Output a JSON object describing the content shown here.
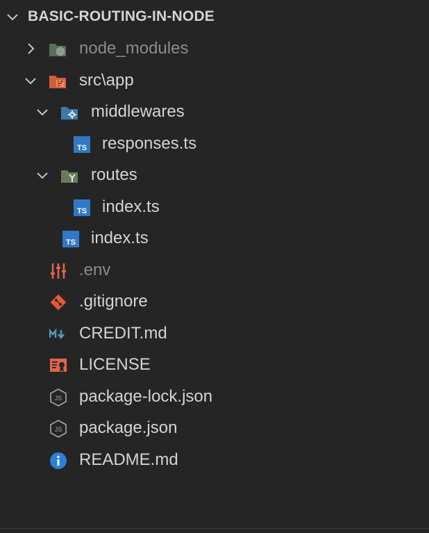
{
  "explorer": {
    "title": "BASIC-ROUTING-IN-NODE",
    "items": [
      {
        "label": "node_modules",
        "kind": "folder-closed",
        "icon": "node-modules-folder-icon"
      },
      {
        "label": "src\\app",
        "kind": "folder-open",
        "icon": "src-folder-icon"
      },
      {
        "label": "middlewares",
        "kind": "folder-open",
        "icon": "middleware-folder-icon"
      },
      {
        "label": "responses.ts",
        "kind": "file",
        "icon": "typescript-icon"
      },
      {
        "label": "routes",
        "kind": "folder-open",
        "icon": "routes-folder-icon"
      },
      {
        "label": "index.ts",
        "kind": "file",
        "icon": "typescript-icon"
      },
      {
        "label": "index.ts",
        "kind": "file",
        "icon": "typescript-icon"
      },
      {
        "label": ".env",
        "kind": "file",
        "icon": "env-icon"
      },
      {
        "label": ".gitignore",
        "kind": "file",
        "icon": "git-icon"
      },
      {
        "label": "CREDIT.md",
        "kind": "file",
        "icon": "markdown-icon"
      },
      {
        "label": "LICENSE",
        "kind": "file",
        "icon": "license-icon"
      },
      {
        "label": "package-lock.json",
        "kind": "file",
        "icon": "nodejs-icon"
      },
      {
        "label": "package.json",
        "kind": "file",
        "icon": "nodejs-icon"
      },
      {
        "label": "README.md",
        "kind": "file",
        "icon": "info-icon"
      }
    ]
  },
  "colors": {
    "background": "#252526",
    "text": "#d4d4d4",
    "dim_text": "#8b8b8b",
    "typescript": "#3178c6",
    "git": "#e55b34",
    "markdown": "#519aba",
    "info": "#2f7fd6"
  }
}
